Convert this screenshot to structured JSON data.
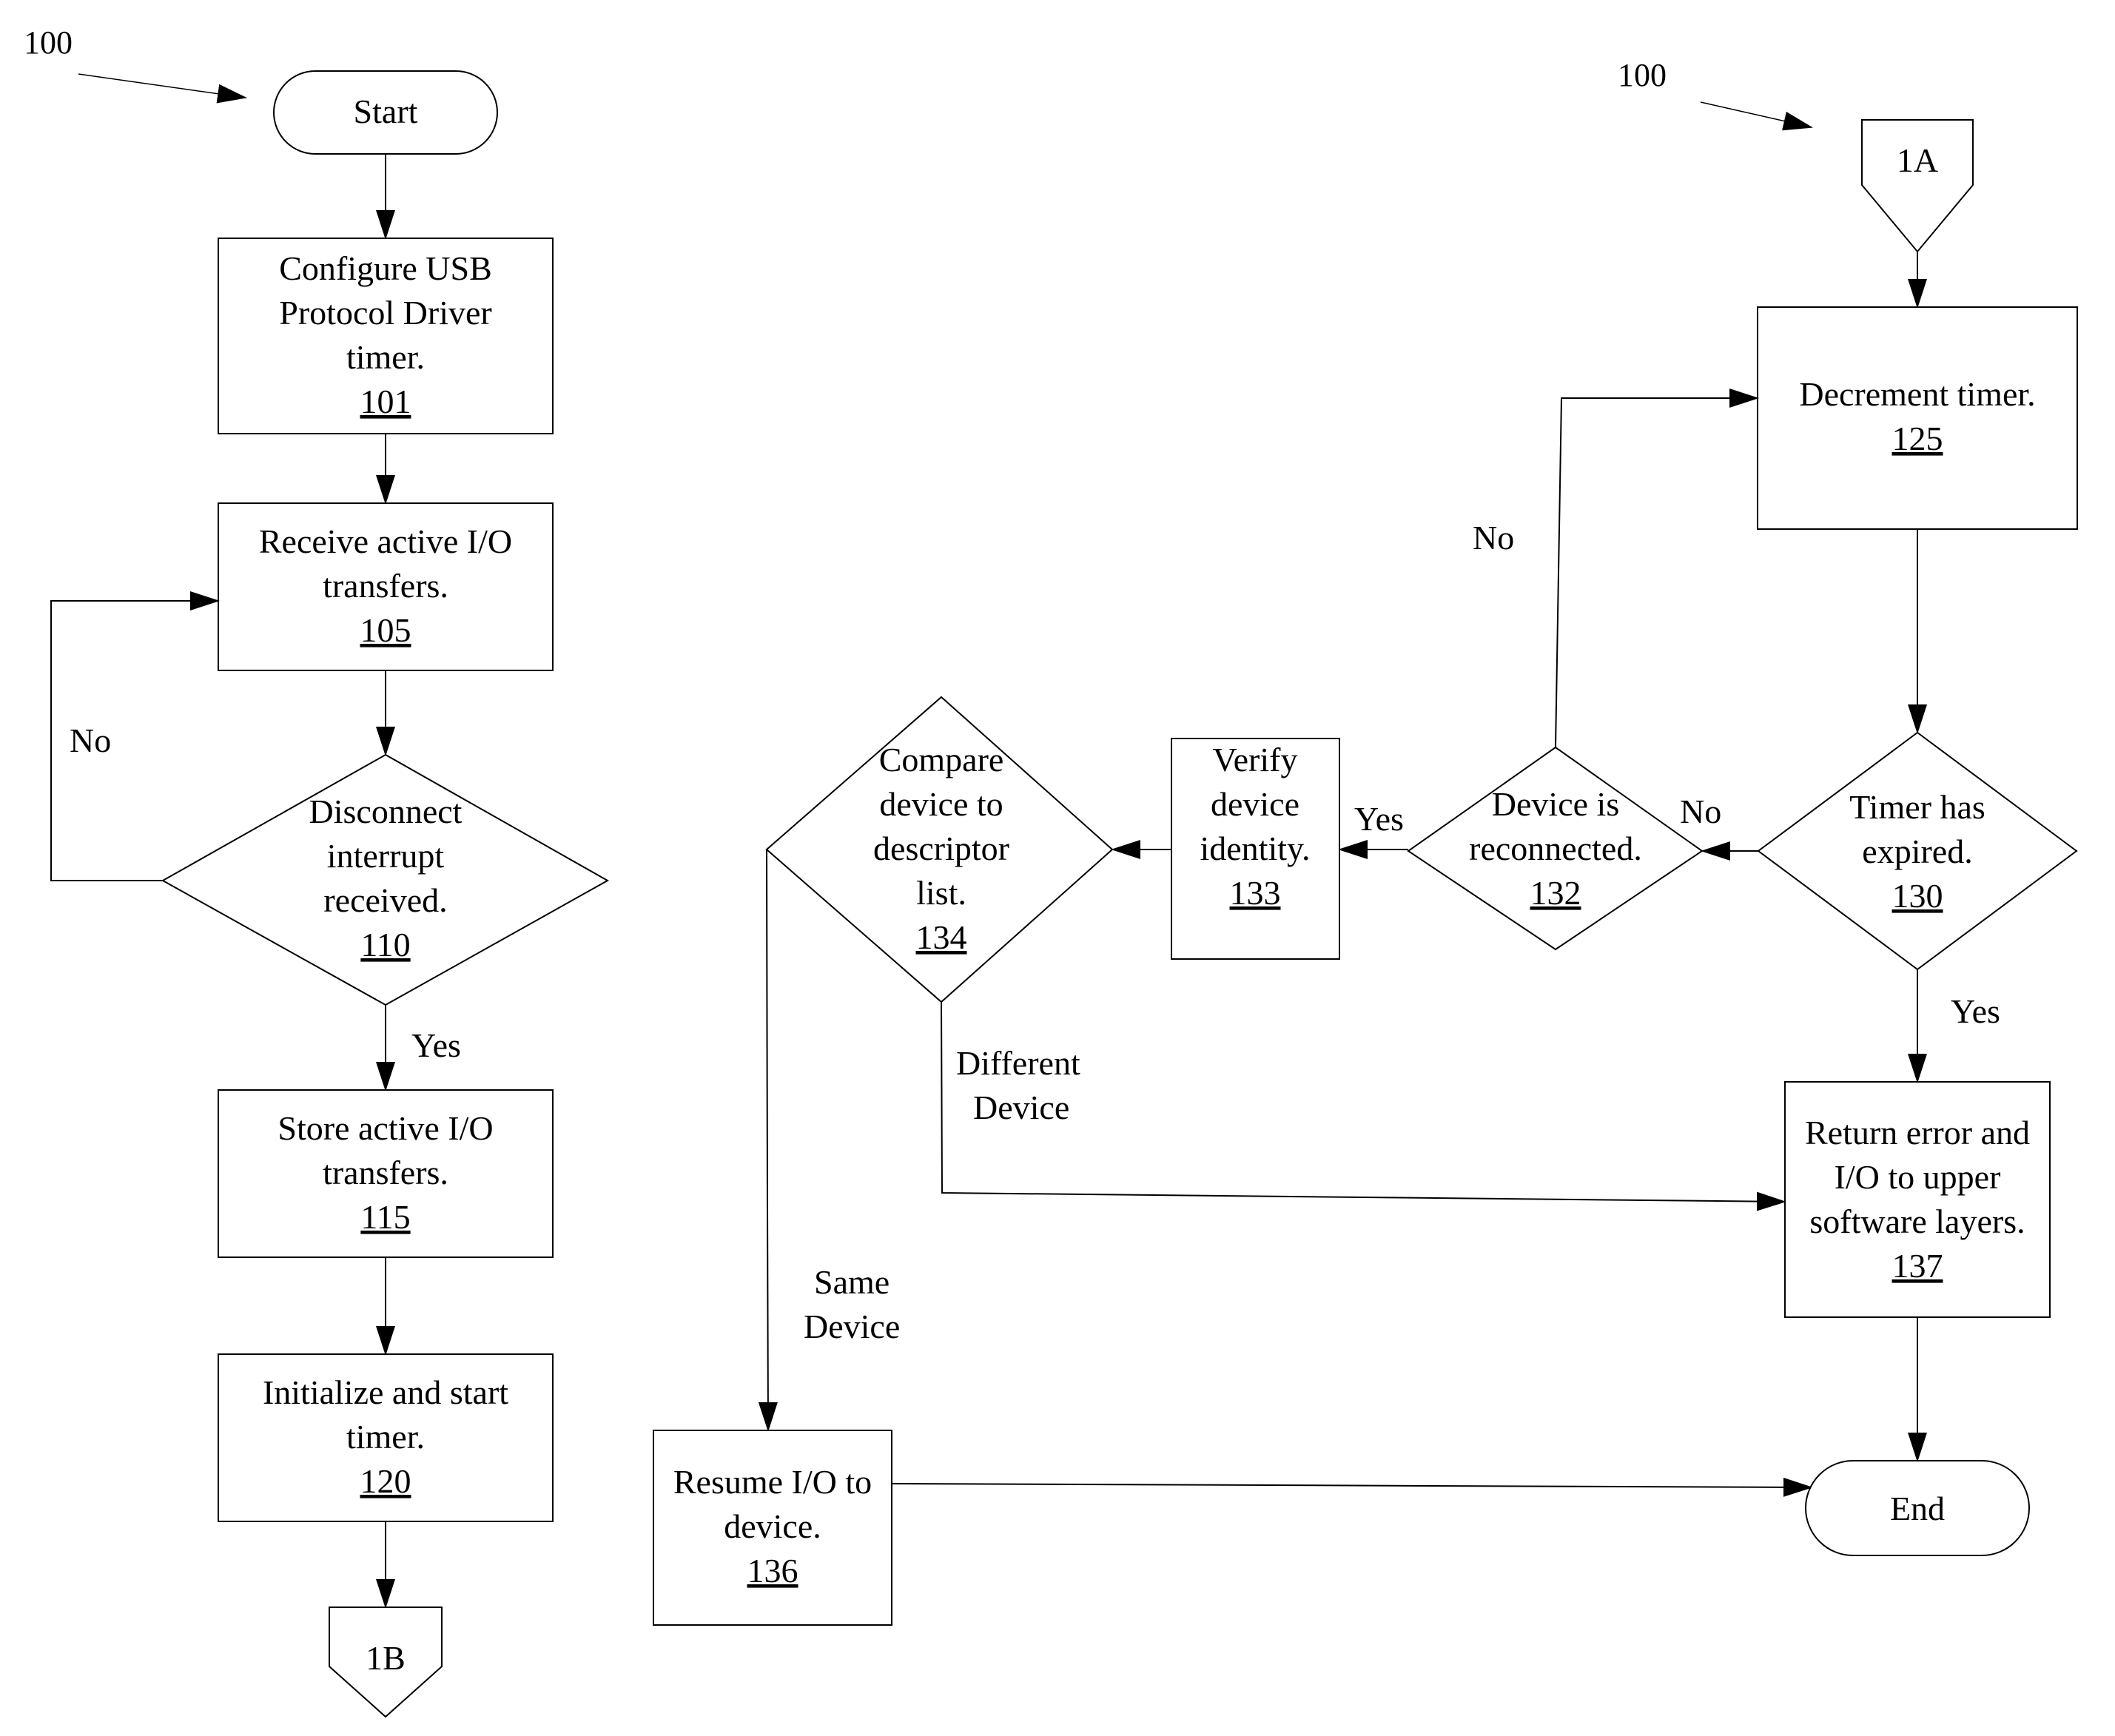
{
  "figure_ref": "100",
  "left_flow": {
    "start": "Start",
    "steps": [
      {
        "id": "101",
        "lines": [
          "Configure USB",
          "Protocol Driver",
          "timer."
        ]
      },
      {
        "id": "105",
        "lines": [
          "Receive active I/O",
          "transfers."
        ]
      },
      {
        "id": "110",
        "lines": [
          "Disconnect",
          "interrupt",
          "received."
        ],
        "type": "decision"
      },
      {
        "id": "115",
        "lines": [
          "Store active I/O",
          "transfers."
        ]
      },
      {
        "id": "120",
        "lines": [
          "Initialize and start",
          "timer."
        ]
      }
    ],
    "edge_labels": {
      "no": "No",
      "yes": "Yes"
    },
    "off_page_connector": "1B"
  },
  "right_flow": {
    "on_page_connector": "1A",
    "steps": [
      {
        "id": "125",
        "lines": [
          "Decrement timer."
        ]
      },
      {
        "id": "130",
        "lines": [
          "Timer has",
          "expired."
        ],
        "type": "decision"
      },
      {
        "id": "132",
        "lines": [
          "Device is",
          "reconnected."
        ],
        "type": "decision"
      },
      {
        "id": "133",
        "lines": [
          "Verify",
          "device",
          "identity."
        ]
      },
      {
        "id": "134",
        "lines": [
          "Compare",
          "device to",
          "descriptor",
          "list."
        ],
        "type": "decision"
      },
      {
        "id": "136",
        "lines": [
          "Resume I/O to",
          "device."
        ]
      },
      {
        "id": "137",
        "lines": [
          "Return error and",
          "I/O to upper",
          "software layers."
        ]
      }
    ],
    "end": "End",
    "edge_labels": {
      "no_132_to_125": "No",
      "no_130_to_132": "No",
      "yes_132_to_133": "Yes",
      "yes_130_to_137": "Yes",
      "different_device": [
        "Different",
        "Device"
      ],
      "same_device": [
        "Same",
        "Device"
      ]
    }
  }
}
